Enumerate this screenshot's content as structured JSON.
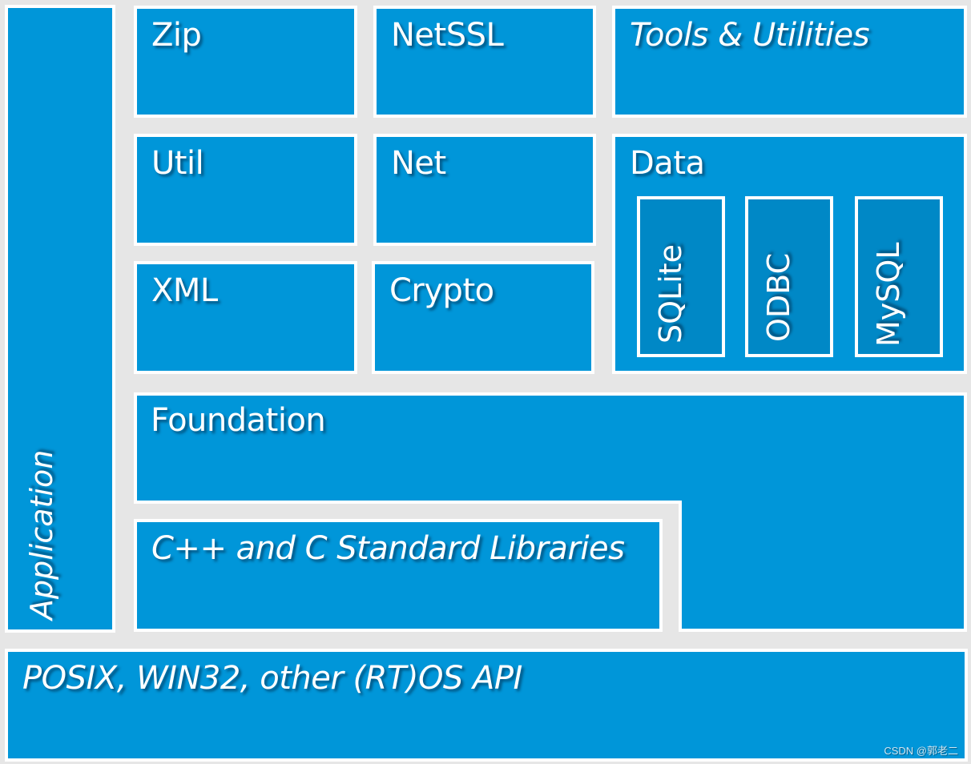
{
  "colors": {
    "block": "#0096d9",
    "inner_block": "#0088c6",
    "background": "#e6e6e6",
    "border": "#ffffff"
  },
  "blocks": {
    "application": "Application",
    "zip": "Zip",
    "netssl": "NetSSL",
    "tools": "Tools & Utilities",
    "util": "Util",
    "net": "Net",
    "data": "Data",
    "xml": "XML",
    "crypto": "Crypto",
    "foundation": "Foundation",
    "stdlib": "C++ and C Standard Libraries",
    "os_api": "POSIX, WIN32, other (RT)OS API"
  },
  "data_connectors": [
    "SQLite",
    "ODBC",
    "MySQL"
  ],
  "watermark": "CSDN @郭老二"
}
